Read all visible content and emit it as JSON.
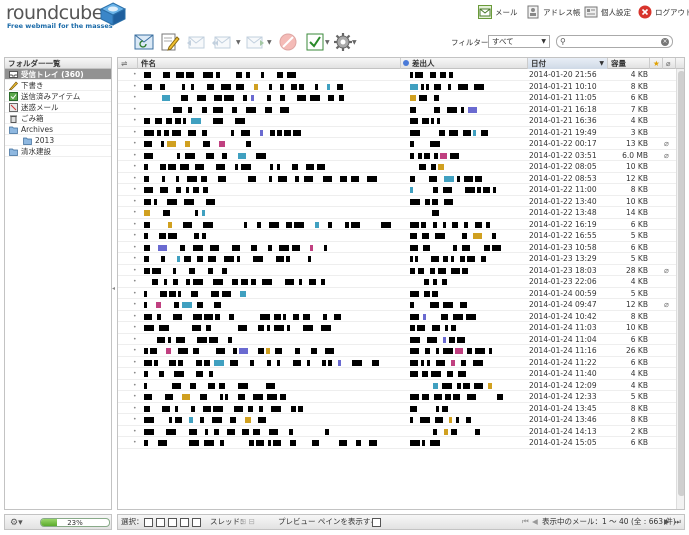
{
  "header": {
    "logo_text": "roundcube",
    "logo_tagline": "Free webmail for the masses",
    "nav": [
      {
        "label": "メール",
        "icon": "mail-icon"
      },
      {
        "label": "アドレス帳",
        "icon": "address-book-icon"
      },
      {
        "label": "個人設定",
        "icon": "settings-icon"
      },
      {
        "label": "ログアウト",
        "icon": "logout-icon"
      }
    ]
  },
  "toolbar": {
    "filter_label": "フィルター：",
    "filter_value": "すべて",
    "search_value": ""
  },
  "folders": {
    "title": "フォルダー一覧",
    "items": [
      {
        "label": "受信トレイ (360)",
        "icon": "inbox-icon",
        "selected": true
      },
      {
        "label": "下書き",
        "icon": "drafts-icon"
      },
      {
        "label": "送信済みアイテム",
        "icon": "sent-icon"
      },
      {
        "label": "迷惑メール",
        "icon": "junk-icon"
      },
      {
        "label": "ごみ箱",
        "icon": "trash-icon"
      },
      {
        "label": "Archives",
        "icon": "folder-icon"
      },
      {
        "label": "2013",
        "icon": "folder-icon",
        "sub": true
      },
      {
        "label": "清水建設",
        "icon": "folder-icon"
      }
    ],
    "quota": "23%",
    "quota_fraction": 0.23
  },
  "list": {
    "columns": {
      "subject": "件名",
      "from": "差出人",
      "date": "日付",
      "size": "容量"
    },
    "rows": [
      {
        "date": "2014-01-20 21:56",
        "size": "4 KB",
        "clip": false
      },
      {
        "date": "2014-01-21 10:10",
        "size": "8 KB",
        "clip": false
      },
      {
        "date": "2014-01-21 11:05",
        "size": "6 KB",
        "clip": false
      },
      {
        "date": "2014-01-21 16:18",
        "size": "7 KB",
        "clip": false
      },
      {
        "date": "2014-01-21 16:36",
        "size": "4 KB",
        "clip": false
      },
      {
        "date": "2014-01-21 19:49",
        "size": "3 KB",
        "clip": false
      },
      {
        "date": "2014-01-22 00:17",
        "size": "13 KB",
        "clip": true
      },
      {
        "date": "2014-01-22 03:51",
        "size": "6.0 MB",
        "clip": true
      },
      {
        "date": "2014-01-22 08:05",
        "size": "10 KB",
        "clip": false
      },
      {
        "date": "2014-01-22 08:53",
        "size": "12 KB",
        "clip": false
      },
      {
        "date": "2014-01-22 11:00",
        "size": "8 KB",
        "clip": false
      },
      {
        "date": "2014-01-22 13:40",
        "size": "10 KB",
        "clip": false
      },
      {
        "date": "2014-01-22 13:48",
        "size": "14 KB",
        "clip": false
      },
      {
        "date": "2014-01-22 16:19",
        "size": "6 KB",
        "clip": false
      },
      {
        "date": "2014-01-22 16:55",
        "size": "5 KB",
        "clip": false
      },
      {
        "date": "2014-01-23 10:58",
        "size": "6 KB",
        "clip": false
      },
      {
        "date": "2014-01-23 13:29",
        "size": "5 KB",
        "clip": false
      },
      {
        "date": "2014-01-23 18:03",
        "size": "28 KB",
        "clip": true
      },
      {
        "date": "2014-01-23 22:06",
        "size": "4 KB",
        "clip": false
      },
      {
        "date": "2014-01-24 00:59",
        "size": "5 KB",
        "clip": false
      },
      {
        "date": "2014-01-24 09:47",
        "size": "12 KB",
        "clip": true
      },
      {
        "date": "2014-01-24 10:42",
        "size": "8 KB",
        "clip": false
      },
      {
        "date": "2014-01-24 11:03",
        "size": "10 KB",
        "clip": false
      },
      {
        "date": "2014-01-24 11:04",
        "size": "6 KB",
        "clip": false
      },
      {
        "date": "2014-01-24 11:16",
        "size": "26 KB",
        "clip": false
      },
      {
        "date": "2014-01-24 11:22",
        "size": "6 KB",
        "clip": false
      },
      {
        "date": "2014-01-24 11:40",
        "size": "4 KB",
        "clip": false
      },
      {
        "date": "2014-01-24 12:09",
        "size": "4 KB",
        "clip": false
      },
      {
        "date": "2014-01-24 12:33",
        "size": "5 KB",
        "clip": false
      },
      {
        "date": "2014-01-24 13:45",
        "size": "8 KB",
        "clip": false
      },
      {
        "date": "2014-01-24 13:46",
        "size": "8 KB",
        "clip": false
      },
      {
        "date": "2014-01-24 14:13",
        "size": "2 KB",
        "clip": false
      },
      {
        "date": "2014-01-24 15:05",
        "size": "6 KB",
        "clip": false
      }
    ]
  },
  "footer": {
    "select_label": "選択：",
    "thread_label": "スレッド：",
    "preview_label": "プレビュー ペインを表示する：",
    "count_text": "表示中のメール：1 ～ 40 (全 : 663 件)"
  }
}
